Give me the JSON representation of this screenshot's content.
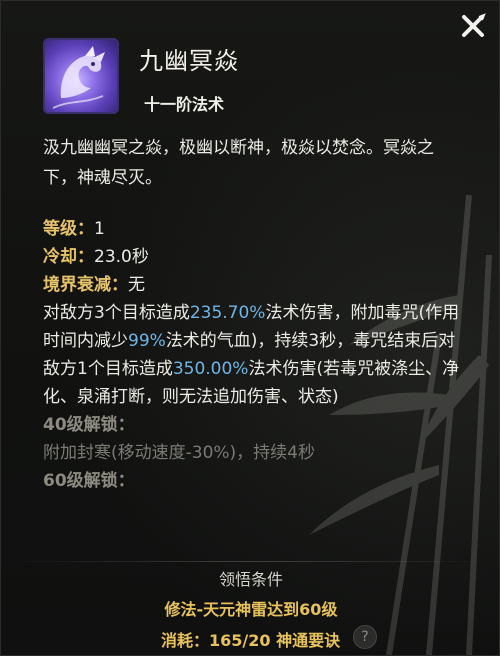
{
  "skill": {
    "name": "九幽冥焱",
    "tier": "十一阶法术",
    "description": "汲九幽幽冥之焱，极幽以断神，极焱以焚念。冥焱之下，神魂尽灭。"
  },
  "stats": {
    "level_label": "等级：",
    "level_value": "1",
    "cooldown_label": "冷却：",
    "cooldown_value": "23.0秒",
    "realm_label": "境界衰减：",
    "realm_value": "无"
  },
  "effect": {
    "p1": "对敌方3个目标造成",
    "h1": "235.70%",
    "p2": "法术伤害，附加毒咒(作用时间内减少",
    "h2": "99%",
    "p3": "法术的气血)，持续3秒，毒咒结束后对敌方1个目标造成",
    "h3": "350.00%",
    "p4": "法术伤害(若毒咒被涤尘、净化、泉涌打断，则无法追加伤害、状态)"
  },
  "unlock40": {
    "title": "40级解锁：",
    "text": "附加封寒(移动速度-30%)，持续4秒"
  },
  "unlock60": {
    "title": "60级解锁："
  },
  "condition": {
    "title": "领悟条件",
    "requirement": "修法-天元神雷达到60级",
    "cost": "消耗：165/20 神通要诀",
    "help": "?"
  },
  "icons": {
    "close": "close-icon",
    "skill": "dragon-skill-icon",
    "help": "question-icon"
  }
}
